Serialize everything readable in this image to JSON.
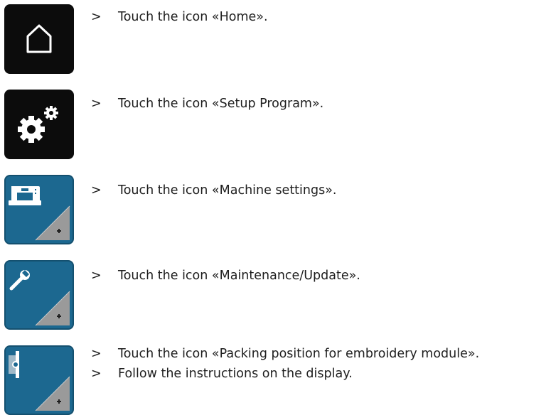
{
  "steps": [
    {
      "marker": ">",
      "text": "Touch the icon «Home»."
    },
    {
      "marker": ">",
      "text": "Touch the icon «Setup Program»."
    },
    {
      "marker": ">",
      "text": "Touch the icon «Machine settings»."
    },
    {
      "marker": ">",
      "text": "Touch the icon «Maintenance/Update»."
    },
    {
      "marker": ">",
      "text": "Touch the icon «Packing position for embroidery module»."
    },
    {
      "marker": ">",
      "text": "Follow the instructions on the display."
    }
  ],
  "icons": [
    {
      "name": "home-icon",
      "style": "black"
    },
    {
      "name": "setup-gears-icon",
      "style": "black"
    },
    {
      "name": "sewing-machine-icon",
      "style": "blue"
    },
    {
      "name": "wrench-icon",
      "style": "blue"
    },
    {
      "name": "embroidery-module-icon",
      "style": "blue"
    }
  ],
  "colors": {
    "icon_dark": "#0c0c0c",
    "icon_blue": "#1c6890",
    "icon_blue_border": "#14506f",
    "corner_triangle": "#9a9a9a",
    "text": "#1e1e1e"
  }
}
